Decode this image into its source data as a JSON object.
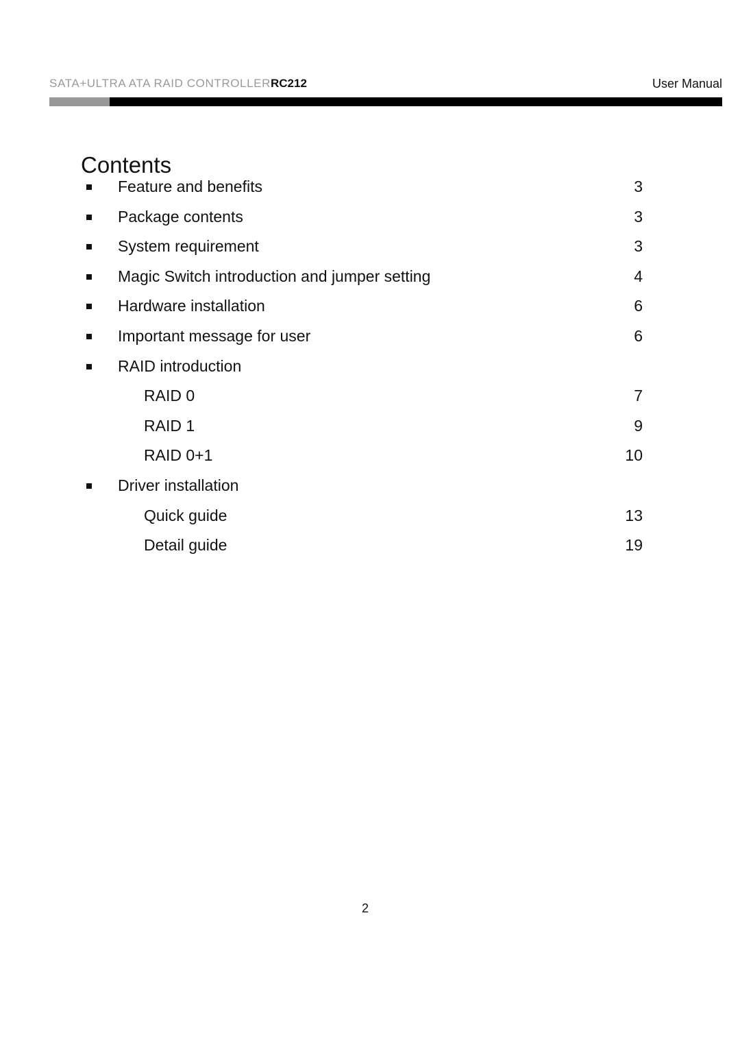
{
  "header": {
    "product_prefix": "SATA+ULTRA ATA RAID CONTROLLER",
    "product_model": "RC212",
    "document_type": "User Manual"
  },
  "contents": {
    "title": "Contents",
    "entries": [
      {
        "label": "Feature and benefits",
        "page": "3",
        "level": 1,
        "bullet": true
      },
      {
        "label": "Package contents",
        "page": "3",
        "level": 1,
        "bullet": true
      },
      {
        "label": "System requirement",
        "page": "3",
        "level": 1,
        "bullet": true
      },
      {
        "label": "Magic Switch introduction and jumper setting",
        "page": "4",
        "level": 1,
        "bullet": true
      },
      {
        "label": "Hardware installation",
        "page": "6",
        "level": 1,
        "bullet": true
      },
      {
        "label": "Important message for user",
        "page": "6",
        "level": 1,
        "bullet": true
      },
      {
        "label": "RAID introduction",
        "page": "",
        "level": 1,
        "bullet": true
      },
      {
        "label": "RAID 0",
        "page": "7",
        "level": 2,
        "bullet": false
      },
      {
        "label": "RAID 1",
        "page": "9",
        "level": 2,
        "bullet": false
      },
      {
        "label": "RAID 0+1",
        "page": "10",
        "level": 2,
        "bullet": false
      },
      {
        "label": "Driver installation",
        "page": "",
        "level": 1,
        "bullet": true
      },
      {
        "label": "Quick guide",
        "page": "13",
        "level": 2,
        "bullet": false
      },
      {
        "label": "Detail guide",
        "page": "19",
        "level": 2,
        "bullet": false
      }
    ]
  },
  "footer": {
    "page_number": "2"
  },
  "colors": {
    "rule_gray": "#989898",
    "rule_black": "#000000",
    "header_prefix_gray": "#9a9a9a",
    "text_black": "#111111"
  }
}
